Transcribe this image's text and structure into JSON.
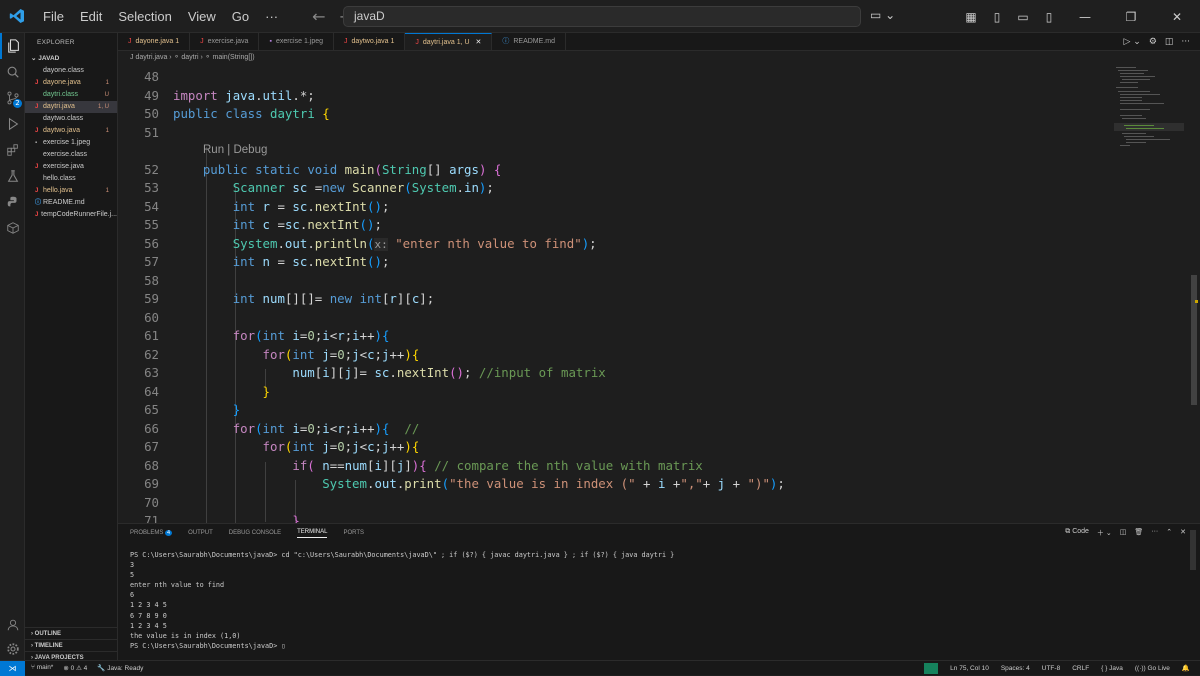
{
  "titlebar": {
    "menu": [
      "File",
      "Edit",
      "Selection",
      "View",
      "Go",
      "···"
    ],
    "search": "javaD",
    "accent": "#0078d4"
  },
  "sidebar": {
    "title": "EXPLORER",
    "folder": "JAVAD",
    "files": [
      {
        "name": "dayone.class",
        "icon": "",
        "color": "#cccccc",
        "status": ""
      },
      {
        "name": "dayone.java",
        "icon": "J",
        "color": "#e2c08d",
        "status": "1"
      },
      {
        "name": "daytri.class",
        "icon": "",
        "color": "#73c991",
        "status": "U"
      },
      {
        "name": "daytri.java",
        "icon": "J",
        "color": "#e2c08d",
        "status": "1, U"
      },
      {
        "name": "daytwo.class",
        "icon": "",
        "color": "#cccccc",
        "status": ""
      },
      {
        "name": "daytwo.java",
        "icon": "J",
        "color": "#e2c08d",
        "status": "1"
      },
      {
        "name": "exercise 1.jpeg",
        "icon": "▪",
        "color": "#cccccc",
        "status": ""
      },
      {
        "name": "exercise.class",
        "icon": "",
        "color": "#cccccc",
        "status": ""
      },
      {
        "name": "exercise.java",
        "icon": "J",
        "color": "#cccccc",
        "status": ""
      },
      {
        "name": "hello.class",
        "icon": "",
        "color": "#cccccc",
        "status": ""
      },
      {
        "name": "hello.java",
        "icon": "J",
        "color": "#e2c08d",
        "status": "1"
      },
      {
        "name": "README.md",
        "icon": "ⓘ",
        "color": "#cccccc",
        "status": ""
      },
      {
        "name": "tempCodeRunnerFile.j...",
        "icon": "J",
        "color": "#cccccc",
        "status": ""
      }
    ],
    "sections": [
      "OUTLINE",
      "TIMELINE",
      "JAVA PROJECTS"
    ]
  },
  "tabs": [
    {
      "label": "dayone.java 1",
      "icon": "J",
      "active": false
    },
    {
      "label": "exercise.java",
      "icon": "J",
      "active": false
    },
    {
      "label": "exercise 1.jpeg",
      "icon": "▪",
      "active": false
    },
    {
      "label": "daytwo.java 1",
      "icon": "J",
      "active": false
    },
    {
      "label": "daytri.java 1, U",
      "icon": "J",
      "active": true
    },
    {
      "label": "README.md",
      "icon": "ⓘ",
      "active": false
    }
  ],
  "breadcrumb": "J  daytri.java  ›  ⚬ daytri  ›  ⚬ main(String[])",
  "editor": {
    "codelens": "Run | Debug",
    "lines": [
      {
        "n": "48",
        "html": ""
      },
      {
        "n": "49",
        "html": "<span class='kc'>import</span> <span class='vr'>java</span>.<span class='vr'>util</span>.*;"
      },
      {
        "n": "50",
        "html": "<span class='kw'>public</span> <span class='kw'>class</span> <span class='ty'>daytri</span> <span class='br1'>{</span>"
      },
      {
        "n": "51",
        "html": ""
      },
      {
        "n": "52",
        "html": "    <span class='kw'>public</span> <span class='kw'>static</span> <span class='kw'>void</span> <span class='fn'>main</span><span class='br2'>(</span><span class='ty'>String</span>[] <span class='vr'>args</span><span class='br2'>)</span> <span class='br2'>{</span>"
      },
      {
        "n": "53",
        "html": "        <span class='ty'>Scanner</span> <span class='vr'>sc</span> =<span class='kw'>new</span> <span class='fn'>Scanner</span><span class='br3'>(</span><span class='ty'>System</span>.<span class='vr'>in</span><span class='br3'>)</span>;"
      },
      {
        "n": "54",
        "html": "        <span class='kw'>int</span> <span class='vr'>r</span> = <span class='vr'>sc</span>.<span class='fn'>nextInt</span><span class='br3'>()</span>;"
      },
      {
        "n": "55",
        "html": "        <span class='kw'>int</span> <span class='vr'>c</span> =<span class='vr'>sc</span>.<span class='fn'>nextInt</span><span class='br3'>()</span>;"
      },
      {
        "n": "56",
        "html": "        <span class='ty'>System</span>.<span class='vr'>out</span>.<span class='fn'>println</span><span class='br3'>(</span><span class='hint'>x:</span> <span class='st'>\"enter nth value to find\"</span><span class='br3'>)</span>;"
      },
      {
        "n": "57",
        "html": "        <span class='kw'>int</span> <span class='vr'>n</span> = <span class='vr'>sc</span>.<span class='fn'>nextInt</span><span class='br3'>()</span>;"
      },
      {
        "n": "58",
        "html": ""
      },
      {
        "n": "59",
        "html": "        <span class='kw'>int</span> <span class='vr'>num</span>[][]= <span class='kw'>new</span> <span class='kw'>int</span>[<span class='vr'>r</span>][<span class='vr'>c</span>];"
      },
      {
        "n": "60",
        "html": ""
      },
      {
        "n": "61",
        "html": "        <span class='kc'>for</span><span class='br3'>(</span><span class='kw'>int</span> <span class='vr'>i</span>=<span class='nm'>0</span>;<span class='vr'>i</span>&lt;<span class='vr'>r</span>;<span class='vr'>i</span>++<span class='br3'>){</span>"
      },
      {
        "n": "62",
        "html": "            <span class='kc'>for</span><span class='br1'>(</span><span class='kw'>int</span> <span class='vr'>j</span>=<span class='nm'>0</span>;<span class='vr'>j</span>&lt;<span class='vr'>c</span>;<span class='vr'>j</span>++<span class='br1'>){</span>"
      },
      {
        "n": "63",
        "html": "                <span class='vr'>num</span>[<span class='vr'>i</span>][<span class='vr'>j</span>]= <span class='vr'>sc</span>.<span class='fn'>nextInt</span><span class='br2'>()</span>; <span class='cm'>//input of matrix</span>"
      },
      {
        "n": "64",
        "html": "            <span class='br1'>}</span>"
      },
      {
        "n": "65",
        "html": "        <span class='br3'>}</span>"
      },
      {
        "n": "66",
        "html": "        <span class='kc'>for</span><span class='br3'>(</span><span class='kw'>int</span> <span class='vr'>i</span>=<span class='nm'>0</span>;<span class='vr'>i</span>&lt;<span class='vr'>r</span>;<span class='vr'>i</span>++<span class='br3'>){</span>  <span class='cm'>//</span>"
      },
      {
        "n": "67",
        "html": "            <span class='kc'>for</span><span class='br1'>(</span><span class='kw'>int</span> <span class='vr'>j</span>=<span class='nm'>0</span>;<span class='vr'>j</span>&lt;<span class='vr'>c</span>;<span class='vr'>j</span>++<span class='br1'>){</span>"
      },
      {
        "n": "68",
        "html": "                <span class='kc'>if</span><span class='br2'>(</span> <span class='vr'>n</span>==<span class='vr'>num</span>[<span class='vr'>i</span>][<span class='vr'>j</span>]<span class='br2'>){</span> <span class='cm'>// compare the nth value with matrix</span>"
      },
      {
        "n": "69",
        "html": "                    <span class='ty'>System</span>.<span class='vr'>out</span>.<span class='fn'>print</span><span class='br3'>(</span><span class='st'>\"the value is in index (\"</span> + <span class='vr'>i</span> +<span class='st'>\",\"</span>+ <span class='vr'>j</span> + <span class='st'>\")\"</span><span class='br3'>)</span>;"
      },
      {
        "n": "70",
        "html": ""
      },
      {
        "n": "71",
        "html": "                <span class='br2'>}</span>"
      }
    ]
  },
  "panel": {
    "tabs": [
      "PROBLEMS",
      "OUTPUT",
      "DEBUG CONSOLE",
      "TERMINAL",
      "PORTS"
    ],
    "problems_count": "4",
    "active": "TERMINAL",
    "shell": "Code",
    "terminal": "PS C:\\Users\\Saurabh\\Documents\\javaD> cd \"c:\\Users\\Saurabh\\Documents\\javaD\\\" ; if ($?) { javac daytri.java } ; if ($?) { java daytri }\n3\n5\nenter nth value to find\n6\n1 2 3 4 5\n6 7 8 9 0\n1 2 3 4 5\nthe value is in index (1,0)\nPS C:\\Users\\Saurabh\\Documents\\javaD> ▯"
  },
  "status": {
    "branch": "main*",
    "errors": "⊗ 0",
    "warnings": "⚠ 4",
    "java": "Java: Ready",
    "position": "Ln 75, Col 10",
    "spaces": "Spaces: 4",
    "encoding": "UTF-8",
    "eol": "CRLF",
    "lang": "{ } Java",
    "golive": "Go Live"
  }
}
